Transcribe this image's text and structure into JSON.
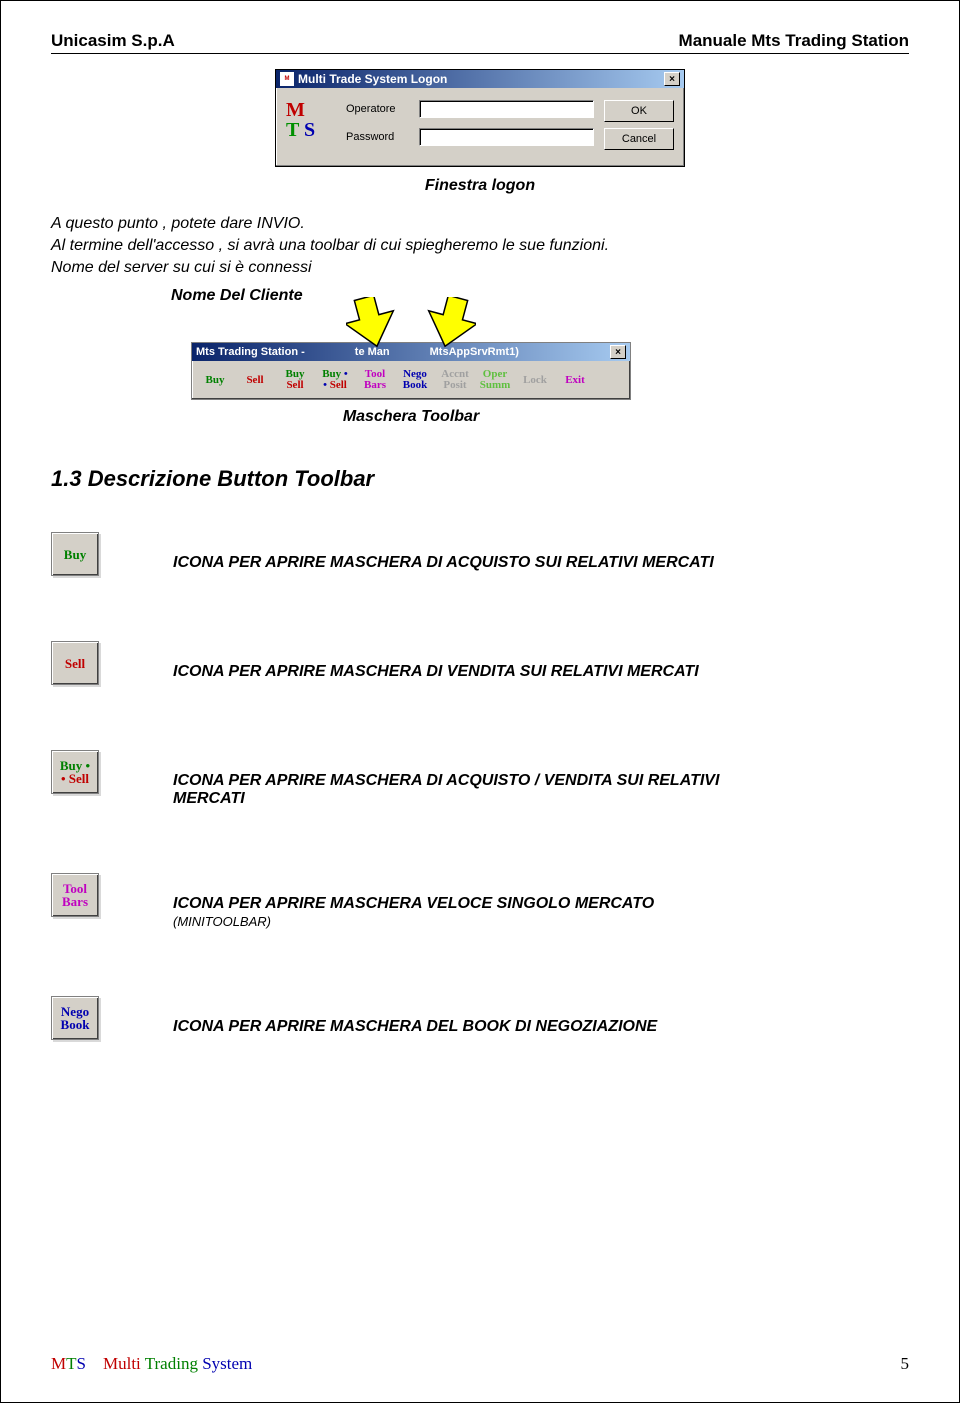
{
  "header": {
    "company": "Unicasim S.p.A",
    "doc_title": "Manuale Mts Trading Station"
  },
  "logon": {
    "title": "Multi Trade System Logon",
    "label_operatore": "Operatore",
    "label_password": "Password",
    "value_operatore": "",
    "value_password": "",
    "ok": "OK",
    "cancel": "Cancel",
    "caption": "Finestra logon",
    "close_x": "×"
  },
  "intro": {
    "line1": "A questo punto , potete dare INVIO.",
    "line2": "Al termine dell'accesso , si avrà una toolbar di cui spiegheremo le sue funzioni.",
    "line3": "Nome del server su cui si è connessi",
    "nome_cliente": "Nome Del Cliente"
  },
  "toolbar": {
    "title_left": "Mts Trading Station -",
    "title_mid": "te Man",
    "title_right": "MtsAppSrvRmt1)",
    "close_x": "×",
    "buttons": {
      "buy": "Buy",
      "sell": "Sell",
      "buysell_top": "Buy",
      "buysell_bot": "Sell",
      "buysell2_top": "Buy",
      "buysell2_bot": "Sell",
      "toolbars_top": "Tool",
      "toolbars_bot": "Bars",
      "nego_top": "Nego",
      "nego_bot": "Book",
      "accnt_top": "Accnt",
      "accnt_bot": "Posit",
      "oper_top": "Oper",
      "oper_bot": "Summ",
      "lock": "Lock",
      "exit": "Exit"
    },
    "caption": "Maschera Toolbar"
  },
  "section_heading": "1.3 Descrizione Button Toolbar",
  "descriptions": [
    {
      "icon_lines": [
        {
          "text": "Buy",
          "cls": "c-green"
        }
      ],
      "text": "ICONA PER APRIRE MASCHERA DI ACQUISTO SUI  RELATIVI MERCATI",
      "sub": ""
    },
    {
      "icon_lines": [
        {
          "text": "Sell",
          "cls": "c-red"
        }
      ],
      "text": "ICONA PER APRIRE MASCHERA DI VENDITA SUI  RELATIVI MERCATI",
      "sub": ""
    },
    {
      "icon_lines": [
        {
          "text": "Buy •",
          "cls": "c-green"
        },
        {
          "text": "• Sell",
          "cls": "c-red"
        }
      ],
      "text": "ICONA PER APRIRE MASCHERA DI ACQUISTO / VENDITA SUI RELATIVI MERCATI",
      "sub": ""
    },
    {
      "icon_lines": [
        {
          "text": "Tool",
          "cls": "c-magenta"
        },
        {
          "text": "Bars",
          "cls": "c-magenta"
        }
      ],
      "text": "ICONA PER APRIRE MASCHERA VELOCE SINGOLO MERCATO",
      "sub": "(MINITOOLBAR)"
    },
    {
      "icon_lines": [
        {
          "text": "Nego",
          "cls": "c-blue"
        },
        {
          "text": "Book",
          "cls": "c-blue"
        }
      ],
      "text": "ICONA PER APRIRE MASCHERA DEL BOOK DI NEGOZIAZIONE",
      "sub": ""
    }
  ],
  "footer": {
    "m": "M",
    "t": "T",
    "s": "S",
    "multi": "Multi",
    "trading": "Trading",
    "system": "System",
    "page": "5"
  }
}
